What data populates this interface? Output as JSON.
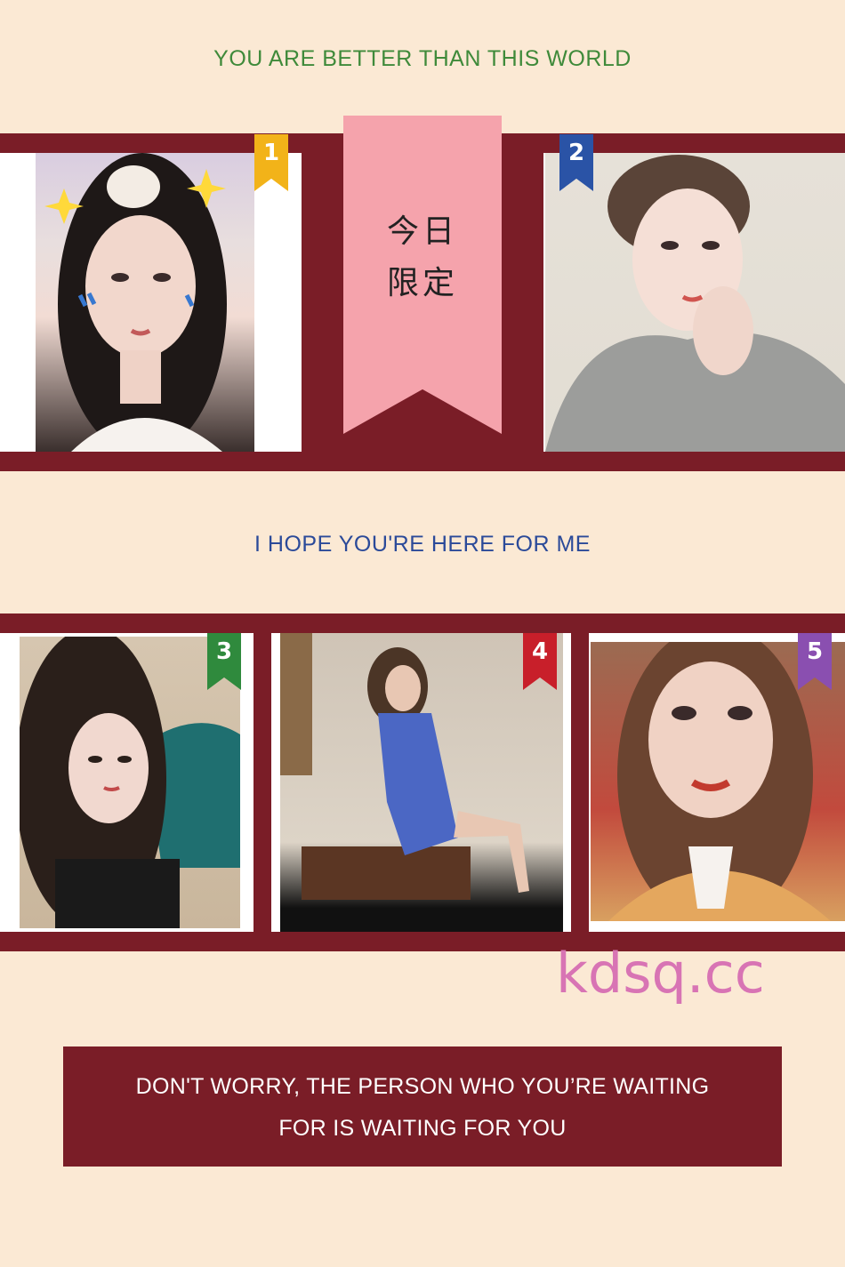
{
  "headings": {
    "top": "YOU ARE BETTER THAN THIS WORLD",
    "middle": "I HOPE YOU'RE HERE FOR ME"
  },
  "ribbon": {
    "line1": "今日",
    "line2": "限定"
  },
  "photos": [
    {
      "badge": "1",
      "badge_color": "#f2b319"
    },
    {
      "badge": "2",
      "badge_color": "#2a53a6"
    },
    {
      "badge": "3",
      "badge_color": "#2f8a3d"
    },
    {
      "badge": "4",
      "badge_color": "#c81f2a"
    },
    {
      "badge": "5",
      "badge_color": "#8a4fb0"
    }
  ],
  "watermark": "kdsq.cc",
  "quote": {
    "line1": "DON'T WORRY, THE PERSON WHO YOU’RE WAITING",
    "line2": "FOR IS WAITING FOR YOU"
  },
  "colors": {
    "background": "#fbe9d4",
    "band": "#7a1d27",
    "ribbon": "#f5a3ac",
    "heading_top": "#3f8a3a",
    "heading_middle": "#2b4a99",
    "watermark": "#d874b4"
  }
}
